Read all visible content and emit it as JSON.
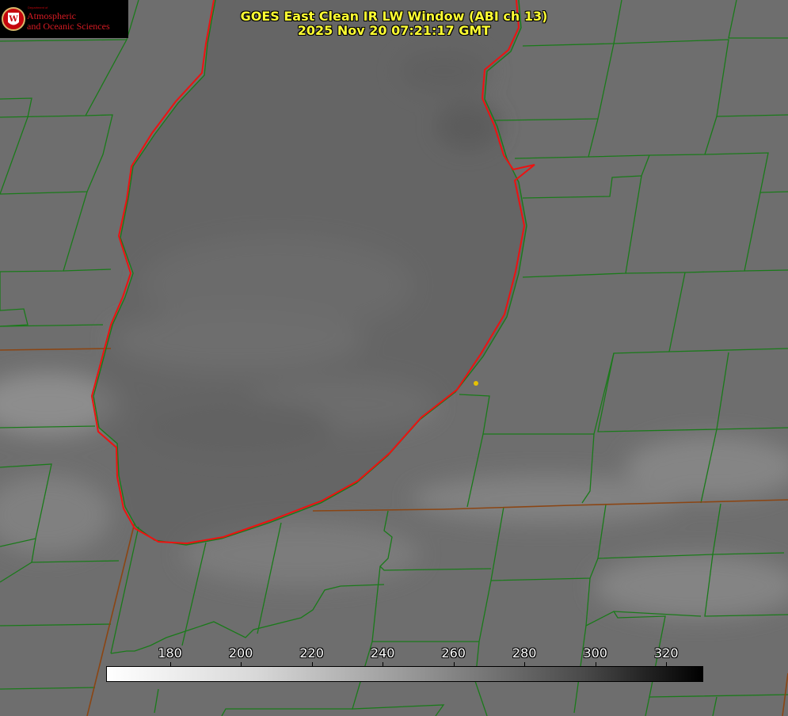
{
  "title": {
    "line1": "GOES East Clean IR LW Window (ABI ch 13)",
    "line2": "2025 Nov 20 07:21:17 GMT"
  },
  "logo": {
    "department": "Department of",
    "line1": "Atmospheric",
    "line2": "and Oceanic Sciences",
    "seal_letter": "W"
  },
  "colorbar": {
    "ticks": [
      "180",
      "200",
      "220",
      "240",
      "260",
      "280",
      "300",
      "320"
    ],
    "range": [
      162,
      330
    ],
    "colormap": "white-to-black (cold bright, warm dark)"
  },
  "colors": {
    "county_lines": "#1a7a1a",
    "state_lines": "#8b4513",
    "lake_outline": "#ee1111",
    "title_text": "#ffff33",
    "site_marker": "#e6c200",
    "background": "#6e6e6e",
    "lake_interior": "#5f5f5f"
  }
}
